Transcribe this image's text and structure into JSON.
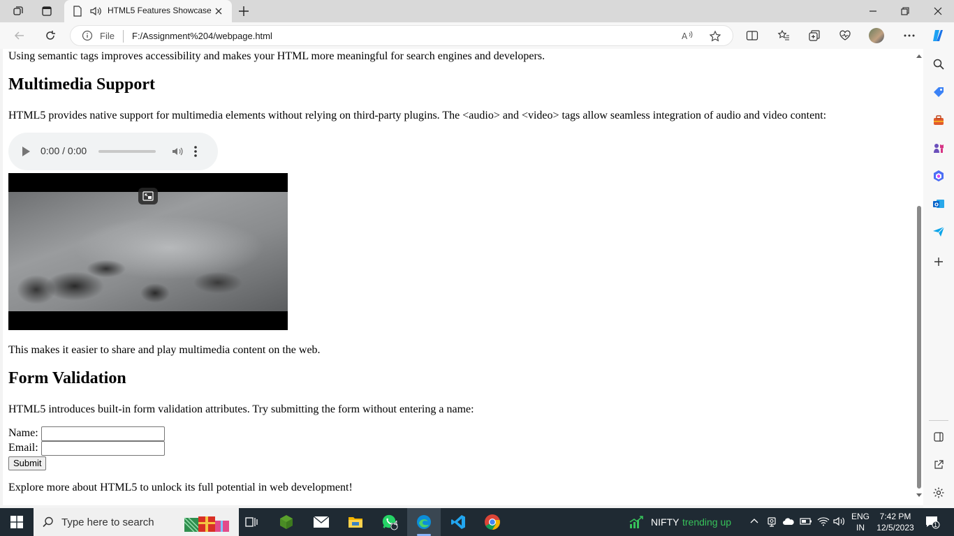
{
  "browser": {
    "tab_title": "HTML5 Features Showcase",
    "address_scheme": "File",
    "address_url": "F:/Assignment%204/webpage.html"
  },
  "page": {
    "semantic_text": "Using semantic tags improves accessibility and makes your HTML more meaningful for search engines and developers.",
    "multimedia_heading": "Multimedia Support",
    "multimedia_text": "HTML5 provides native support for multimedia elements without relying on third-party plugins. The <audio> and <video> tags allow seamless integration of audio and video content:",
    "audio_time": "0:00 / 0:00",
    "multimedia_after": "This makes it easier to share and play multimedia content on the web.",
    "form_heading": "Form Validation",
    "form_text": "HTML5 introduces built-in form validation attributes. Try submitting the form without entering a name:",
    "name_label": "Name:",
    "email_label": "Email:",
    "name_value": "",
    "email_value": "",
    "submit_label": "Submit",
    "footer_text": "Explore more about HTML5 to unlock its full potential in web development!"
  },
  "taskbar": {
    "search_placeholder": "Type here to search",
    "whatsapp_badge": "4",
    "nifty_label": "NIFTY",
    "nifty_status": "trending up",
    "lang_line1": "ENG",
    "lang_line2": "IN",
    "time": "7:42 PM",
    "date": "12/5/2023",
    "notification_count": "1"
  },
  "colors": {
    "accent": "#0078d4",
    "trend_green": "#37c15a",
    "taskbar_bg": "#1f2a33"
  }
}
